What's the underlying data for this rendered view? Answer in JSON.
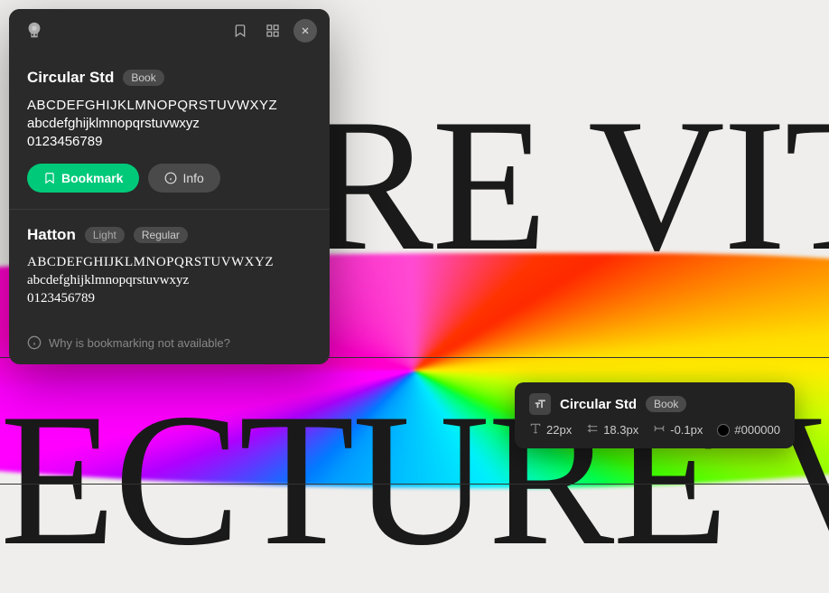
{
  "panel": {
    "logo_alt": "Fontanello logo",
    "font1": {
      "name": "Circular Std",
      "style": "Book",
      "preview_upper": "ABCDEFGHIJKLMNOPQRSTUVWXYZ",
      "preview_lower": "abcdefghijklmnopqrstuvwxyz",
      "preview_nums": "0123456789"
    },
    "buttons": {
      "bookmark": "Bookmark",
      "info": "Info"
    },
    "font2": {
      "name": "Hatton",
      "style_light": "Light",
      "style_regular": "Regular",
      "preview_upper": "ABCDEFGHIJKLMNOPQRSTUVWXYZ",
      "preview_lower": "abcdefghijklmnopqrstuvwxyz",
      "preview_nums": "0123456789"
    },
    "notice": "Why is bookmarking not available?"
  },
  "tooltip": {
    "font_name": "Circular Std",
    "style": "Book",
    "font_size": "22px",
    "line_height": "18.3px",
    "letter_spacing": "-0.1px",
    "color": "#000000"
  },
  "background": {
    "text_top": "RE VITA",
    "text_bottom": "ECTURE V"
  }
}
